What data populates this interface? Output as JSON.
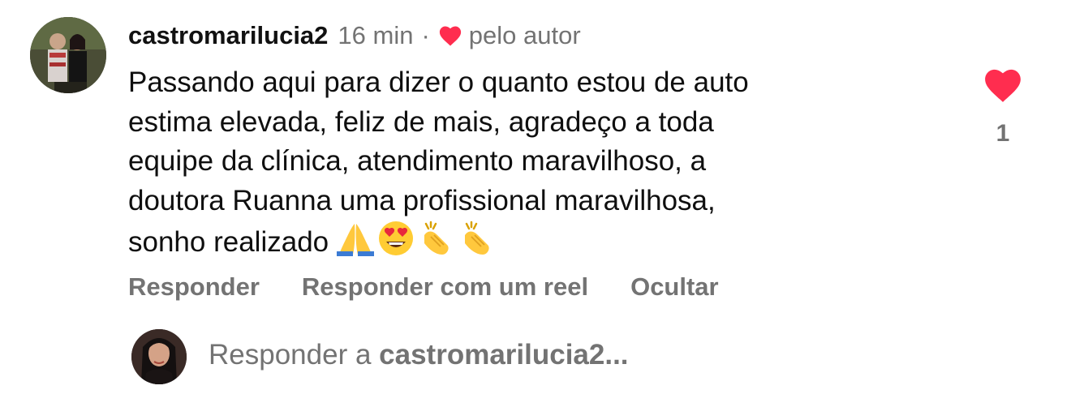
{
  "comment": {
    "username": "castromarilucia2",
    "time": "16 min",
    "separator": "·",
    "author_badge": "pelo autor",
    "text_lines": [
      "Passando aqui para dizer o quanto estou de auto",
      "estima elevada, feliz de mais, agradeço a toda",
      "equipe da clínica, atendimento maravilhoso, a",
      "doutora Ruanna uma profissional maravilhosa,",
      "sonho realizado"
    ],
    "emojis": [
      "folded-hands",
      "smiling-face-heart-eyes",
      "clapping-hands",
      "clapping-hands"
    ],
    "like_count": "1"
  },
  "actions": {
    "reply": "Responder",
    "reply_reel": "Responder com um reel",
    "hide": "Ocultar"
  },
  "reply_box": {
    "prefix": "Responder a",
    "target": "castromarilucia2...",
    "placeholder": "Responder a castromarilucia2..."
  },
  "colors": {
    "heart": "#ff2d4f",
    "muted": "#737373",
    "text": "#0f0f0f"
  }
}
